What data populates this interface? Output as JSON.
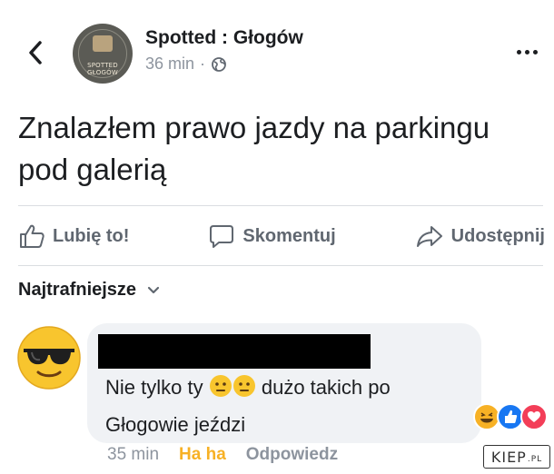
{
  "header": {
    "back_icon": "chevron-left-icon",
    "page_name": "Spotted : Głogów",
    "time": "36 min",
    "separator": "·",
    "privacy_icon": "globe-icon",
    "avatar_text": "SPOTTED GŁOGÓW",
    "more_icon": "ellipsis-icon"
  },
  "post": {
    "text": "Znalazłem prawo jazdy na parkingu pod galerią"
  },
  "actions": {
    "like": "Lubię to!",
    "comment": "Skomentuj",
    "share": "Udostępnij"
  },
  "sort": {
    "label": "Najtrafniejsze"
  },
  "comment": {
    "avatar_icon": "sunglasses-emoji-icon",
    "text_before": "Nie tylko ty",
    "text_after": "dużo takich po Głogowie jeździ",
    "emojis": [
      "neutral-face-emoji",
      "neutral-face-emoji"
    ],
    "reactions": [
      "haha",
      "like",
      "love"
    ],
    "time": "35 min",
    "reaction_label": "Ha ha",
    "reply_label": "Odpowiedz"
  },
  "watermark": {
    "main": "KIEP",
    "suffix": ".PL"
  },
  "colors": {
    "text": "#1c1e21",
    "muted": "#8d949e",
    "action": "#606770",
    "haha": "#f7b125",
    "like_blue": "#1877f2",
    "love_red": "#f33e58",
    "bubble": "#f0f2f5"
  }
}
